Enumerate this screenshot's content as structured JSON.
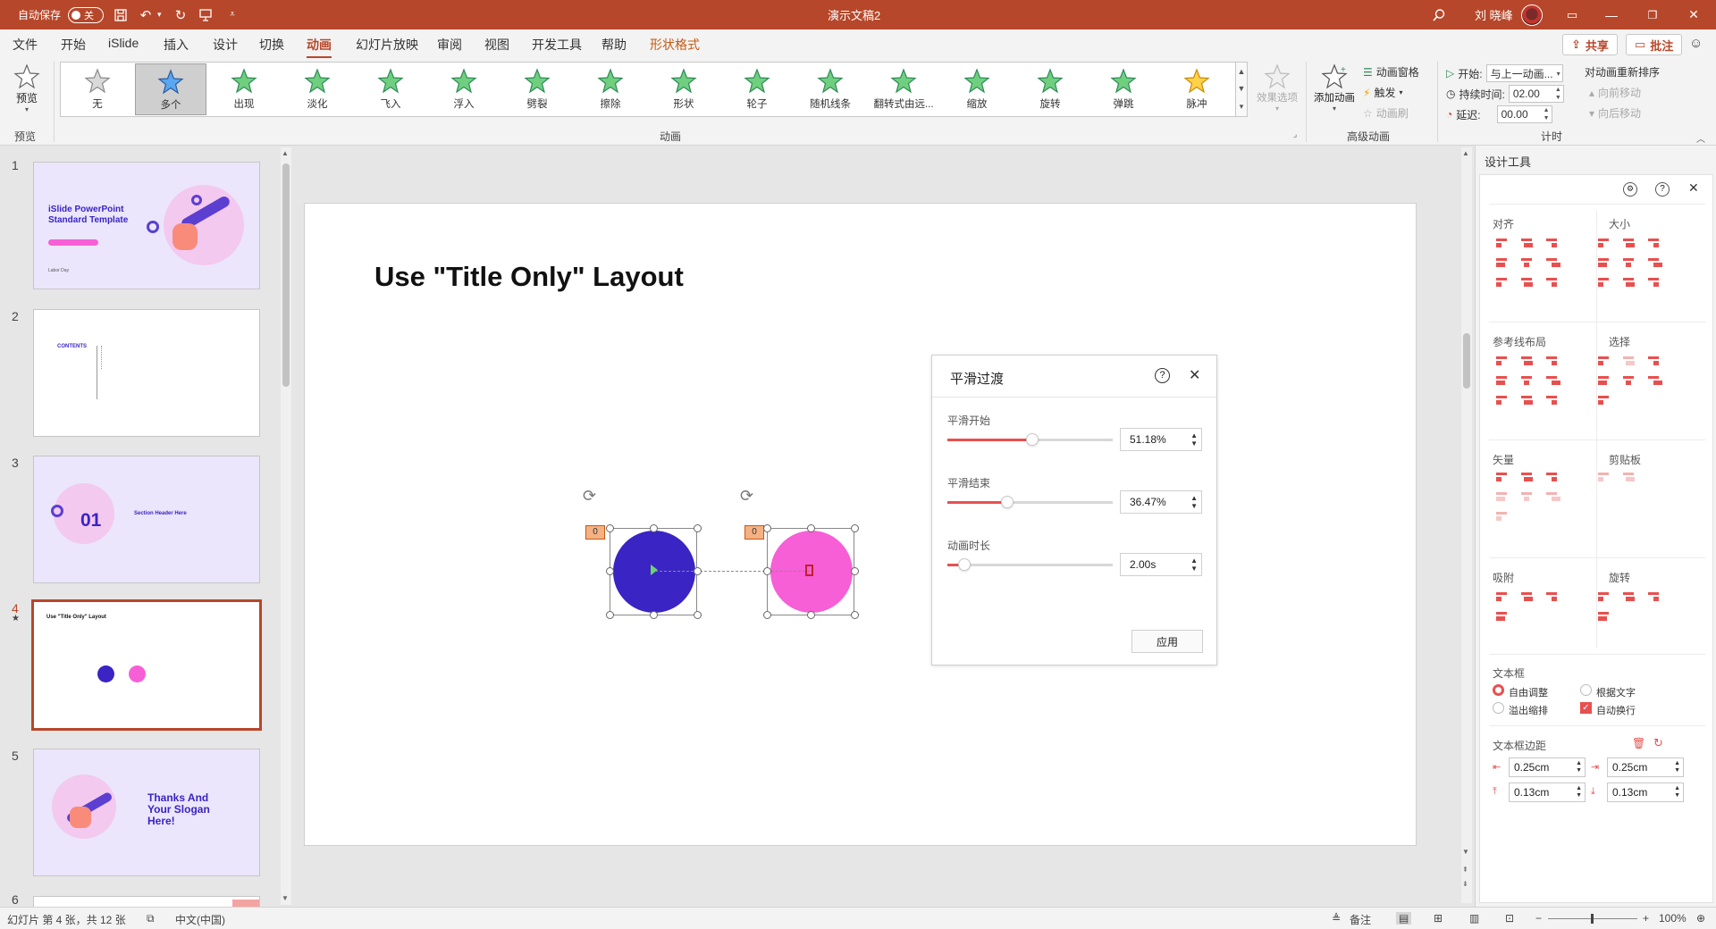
{
  "colors": {
    "accent": "#b7472a",
    "tool_red": "#e8504f",
    "circle_blue": "#3a24c4",
    "circle_pink": "#f75fd6",
    "thumb_lavender": "#ebe6fb"
  },
  "titlebar": {
    "autosave_label": "自动保存",
    "autosave_state": "关",
    "doc_title": "演示文稿2",
    "user_name": "刘 晓峰",
    "icons": [
      "save-icon",
      "undo-icon",
      "redo-icon",
      "present-icon",
      "customize-icon",
      "search-icon",
      "ribbon-display-icon",
      "minimize-icon",
      "restore-icon",
      "close-icon"
    ]
  },
  "tabs": [
    "文件",
    "开始",
    "iSlide",
    "插入",
    "设计",
    "切换",
    "动画",
    "幻灯片放映",
    "审阅",
    "视图",
    "开发工具",
    "帮助",
    "形状格式"
  ],
  "active_tab": "动画",
  "share_label": "共享",
  "comment_label": "批注",
  "ribbon": {
    "preview_label": "预览",
    "preview_group": "预览",
    "gallery": [
      {
        "label": "无",
        "icon": "star-gray-icon"
      },
      {
        "label": "多个",
        "icon": "star-blue-icon",
        "selected": true
      },
      {
        "label": "出现",
        "icon": "star-green-icon"
      },
      {
        "label": "淡化",
        "icon": "star-green-icon"
      },
      {
        "label": "飞入",
        "icon": "star-green-icon"
      },
      {
        "label": "浮入",
        "icon": "star-green-icon"
      },
      {
        "label": "劈裂",
        "icon": "star-green-icon"
      },
      {
        "label": "擦除",
        "icon": "star-green-icon"
      },
      {
        "label": "形状",
        "icon": "star-green-icon"
      },
      {
        "label": "轮子",
        "icon": "star-green-icon"
      },
      {
        "label": "随机线条",
        "icon": "star-green-icon"
      },
      {
        "label": "翻转式由远...",
        "icon": "star-green-icon"
      },
      {
        "label": "缩放",
        "icon": "star-green-icon"
      },
      {
        "label": "旋转",
        "icon": "star-green-icon"
      },
      {
        "label": "弹跳",
        "icon": "star-green-icon"
      },
      {
        "label": "脉冲",
        "icon": "star-yellow-icon"
      }
    ],
    "effect_options_label": "效果选项",
    "animation_group": "动画",
    "add_animation_label": "添加动画",
    "animation_pane_label": "动画窗格",
    "trigger_label": "触发",
    "animation_painter_label": "动画刷",
    "advanced_group": "高级动画",
    "start_label": "开始:",
    "start_value": "与上一动画...",
    "duration_label": "持续时间:",
    "duration_value": "02.00",
    "delay_label": "延迟:",
    "delay_value": "00.00",
    "reorder_label": "对动画重新排序",
    "move_earlier_label": "向前移动",
    "move_later_label": "向后移动",
    "timing_group": "计时"
  },
  "slides": [
    {
      "num": "1",
      "title": "iSlide PowerPoint Standard Template",
      "subtitle": "Labor Day"
    },
    {
      "num": "2",
      "title": "CONTENTS"
    },
    {
      "num": "3",
      "title": "01",
      "subtitle": "Section Header Here"
    },
    {
      "num": "4",
      "title": "Use \"Title Only\" Layout",
      "active": true
    },
    {
      "num": "5",
      "title": "Thanks And Your Slogan Here!"
    },
    {
      "num": "6"
    }
  ],
  "slide": {
    "title": "Use \"Title Only\" Layout",
    "anim_tag_1": "0",
    "anim_tag_2": "0"
  },
  "dialog": {
    "title": "平滑过渡",
    "start_label": "平滑开始",
    "start_value": "51.18%",
    "start_fraction": 0.5118,
    "end_label": "平滑结束",
    "end_value": "36.47%",
    "end_fraction": 0.3647,
    "duration_label": "动画时长",
    "duration_value": "2.00s",
    "duration_fraction": 0.1,
    "apply_label": "应用"
  },
  "tools": {
    "title": "设计工具",
    "sections": {
      "align": "对齐",
      "size": "大小",
      "guides": "参考线布局",
      "select": "选择",
      "vector": "矢量",
      "clipboard": "剪贴板",
      "snap": "吸附",
      "rotate": "旋转",
      "textbox": "文本框",
      "margin": "文本框边距"
    },
    "textbox_options": {
      "autofit": "自由调整",
      "fit_text": "根据文字",
      "shrink": "溢出缩排",
      "wrap": "自动换行"
    },
    "margins": {
      "left": "0.25cm",
      "right": "0.25cm",
      "top": "0.13cm",
      "bottom": "0.13cm"
    }
  },
  "status": {
    "slide_info": "幻灯片 第 4 张，共 12 张",
    "language": "中文(中国)",
    "notes_label": "备注",
    "zoom": "100%"
  }
}
